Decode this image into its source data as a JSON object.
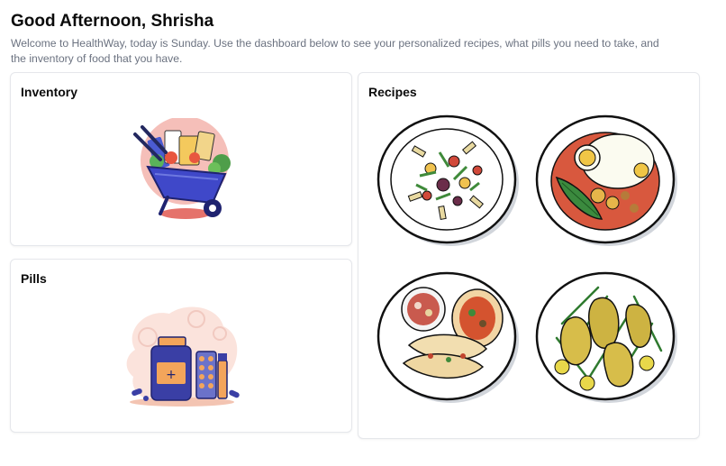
{
  "header": {
    "greeting": "Good Afternoon, Shrisha",
    "subtitle": "Welcome to HealthWay, today is Sunday. Use the dashboard below to see your personalized recipes, what pills you need to take, and the inventory of food that you have."
  },
  "cards": {
    "inventory": {
      "title": "Inventory"
    },
    "pills": {
      "title": "Pills"
    },
    "recipes": {
      "title": "Recipes"
    }
  },
  "icons": {
    "inventory": "wheelbarrow-groceries-icon",
    "pills": "pill-bottle-icon",
    "recipes": [
      "pasta-salad-plate",
      "shakshuka-plate",
      "tacos-plate",
      "grilled-chicken-beans-plate"
    ]
  },
  "colors": {
    "title": "#0b0b0b",
    "subtitle": "#6b7280",
    "card_border": "#e5e7eb",
    "inventory_bg_circle": "#f5bfb9",
    "wheelbarrow": "#3f48c9",
    "pill_bottle": "#3a3fa5",
    "pill_label": "#f3a55b"
  }
}
